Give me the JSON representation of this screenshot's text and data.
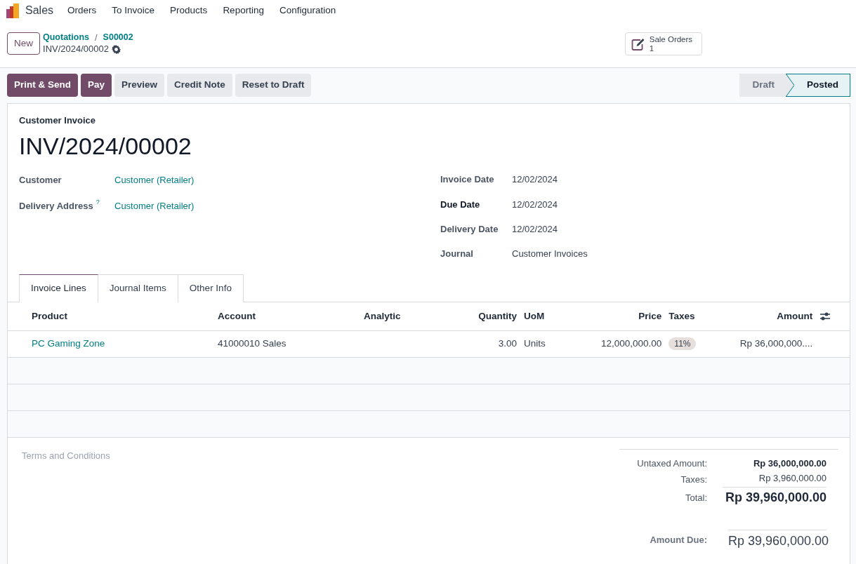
{
  "app": {
    "name": "Sales"
  },
  "menu": [
    "Orders",
    "To Invoice",
    "Products",
    "Reporting",
    "Configuration"
  ],
  "control_panel": {
    "new_button": "New",
    "breadcrumbs": [
      "Quotations",
      "S00002"
    ],
    "breadcrumb_separator": "/",
    "record_name": "INV/2024/00002",
    "smart_button": {
      "label": "Sale Orders",
      "value": "1"
    }
  },
  "actions": [
    {
      "label": "Print & Send",
      "kind": "primary"
    },
    {
      "label": "Pay",
      "kind": "primary"
    },
    {
      "label": "Preview",
      "kind": "secondary"
    },
    {
      "label": "Credit Note",
      "kind": "secondary"
    },
    {
      "label": "Reset to Draft",
      "kind": "secondary"
    }
  ],
  "status_steps": [
    {
      "label": "Draft",
      "selected": false
    },
    {
      "label": "Posted",
      "selected": true
    }
  ],
  "sheet": {
    "type_label": "Customer Invoice",
    "name": "INV/2024/00002",
    "left_fields": [
      {
        "label": "Customer",
        "value": "Customer (Retailer)"
      },
      {
        "label": "Delivery Address",
        "help": "?",
        "value": "Customer (Retailer)"
      }
    ],
    "right_fields": [
      {
        "label": "Invoice Date",
        "value": "12/02/2024",
        "required": false
      },
      {
        "label": "Due Date",
        "value": "12/02/2024",
        "required": true
      },
      {
        "label": "Delivery Date",
        "value": "12/02/2024",
        "required": false
      },
      {
        "label": "Journal",
        "value": "Customer Invoices",
        "required": false
      }
    ]
  },
  "tabs": [
    {
      "label": "Invoice Lines",
      "selected": true
    },
    {
      "label": "Journal Items",
      "selected": false
    },
    {
      "label": "Other Info",
      "selected": false
    }
  ],
  "table": {
    "columns": [
      {
        "label": "Product"
      },
      {
        "label": "Account"
      },
      {
        "label": "Analytic"
      },
      {
        "label": "Quantity"
      },
      {
        "label": "UoM"
      },
      {
        "label": "Price"
      },
      {
        "label": "Taxes"
      },
      {
        "label": "Amount"
      }
    ],
    "rows": [
      {
        "cells": [
          {
            "kind": "link",
            "text": "PC Gaming Zone"
          },
          {
            "kind": "text",
            "text": "41000010 Sales"
          },
          {
            "kind": "empty"
          },
          {
            "kind": "text",
            "text": "3.00"
          },
          {
            "kind": "text",
            "text": "Units"
          },
          {
            "kind": "text",
            "text": "12,000,000.00"
          },
          {
            "kind": "tag",
            "text": "11%"
          },
          {
            "kind": "text",
            "text": "Rp 36,000,000...."
          }
        ]
      }
    ]
  },
  "terms_placeholder": "Terms and Conditions",
  "totals": [
    {
      "label": "Untaxed Amount:",
      "value": "Rp 36,000,000.00",
      "kind": "subtotal"
    },
    {
      "label": "Taxes:",
      "value": "Rp 3,960,000.00",
      "kind": "tax"
    },
    {
      "label": "Total:",
      "value": "Rp 39,960,000.00",
      "kind": "total"
    }
  ],
  "amount_due": {
    "label": "Amount Due:",
    "value": "Rp 39,960,000.00"
  }
}
